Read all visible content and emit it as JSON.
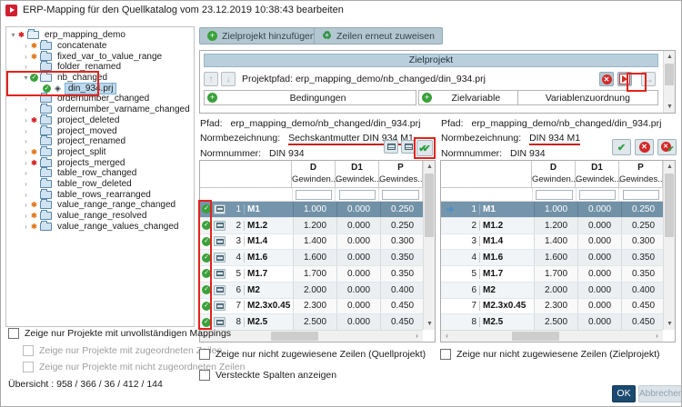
{
  "window": {
    "title": "ERP-Mapping für den Quellkatalog vom 23.12.2019 10:38:43 bearbeiten"
  },
  "toolbar": {
    "add_target_label": "Zielprojekt hinzufügen",
    "reassign_rows_label": "Zeilen erneut zuweisen"
  },
  "tree": {
    "items": [
      {
        "label": "erp_mapping_demo",
        "level": 0,
        "badge": "error",
        "icon": "folder-open",
        "expander": "expanded",
        "selected": false
      },
      {
        "label": "concatenate",
        "level": 1,
        "badge": "warning",
        "icon": "folder",
        "expander": "collapsed",
        "selected": false
      },
      {
        "label": "fixed_var_to_value_range",
        "level": 1,
        "badge": "warning",
        "icon": "folder",
        "expander": "collapsed",
        "selected": false
      },
      {
        "label": "folder_renamed",
        "level": 1,
        "badge": "none",
        "icon": "folder",
        "expander": "collapsed",
        "selected": false
      },
      {
        "label": "nb_changed",
        "level": 1,
        "badge": "ok",
        "icon": "folder-open",
        "expander": "expanded",
        "selected": false
      },
      {
        "label": "din_934.prj",
        "level": 2,
        "badge": "ok",
        "icon": "project",
        "expander": "none",
        "selected": true
      },
      {
        "label": "ordernumber_changed",
        "level": 1,
        "badge": "none",
        "icon": "folder",
        "expander": "collapsed",
        "selected": false
      },
      {
        "label": "ordernumber_varname_changed",
        "level": 1,
        "badge": "none",
        "icon": "folder",
        "expander": "collapsed",
        "selected": false
      },
      {
        "label": "project_deleted",
        "level": 1,
        "badge": "error",
        "icon": "folder",
        "expander": "collapsed",
        "selected": false
      },
      {
        "label": "project_moved",
        "level": 1,
        "badge": "none",
        "icon": "folder",
        "expander": "collapsed",
        "selected": false
      },
      {
        "label": "project_renamed",
        "level": 1,
        "badge": "none",
        "icon": "folder",
        "expander": "collapsed",
        "selected": false
      },
      {
        "label": "project_split",
        "level": 1,
        "badge": "warning",
        "icon": "folder",
        "expander": "collapsed",
        "selected": false
      },
      {
        "label": "projects_merged",
        "level": 1,
        "badge": "error",
        "icon": "folder",
        "expander": "collapsed",
        "selected": false
      },
      {
        "label": "table_row_changed",
        "level": 1,
        "badge": "none",
        "icon": "folder",
        "expander": "collapsed",
        "selected": false
      },
      {
        "label": "table_row_deleted",
        "level": 1,
        "badge": "none",
        "icon": "folder",
        "expander": "collapsed",
        "selected": false
      },
      {
        "label": "table_rows_rearranged",
        "level": 1,
        "badge": "none",
        "icon": "folder",
        "expander": "collapsed",
        "selected": false
      },
      {
        "label": "value_range_range_changed",
        "level": 1,
        "badge": "warning",
        "icon": "folder",
        "expander": "collapsed",
        "selected": false
      },
      {
        "label": "value_range_resolved",
        "level": 1,
        "badge": "warning",
        "icon": "folder",
        "expander": "collapsed",
        "selected": false
      },
      {
        "label": "value_range_values_changed",
        "level": 1,
        "badge": "warning",
        "icon": "folder",
        "expander": "collapsed",
        "selected": false
      }
    ]
  },
  "target_panel": {
    "header": "Zielprojekt",
    "project_path_label": "Projektpfad:",
    "project_path": "erp_mapping_demo/nb_changed/din_934.prj",
    "conditions_column": "Bedingungen",
    "target_variable_column": "Zielvariable",
    "variable_mapping_column": "Variablenzuordnung"
  },
  "source_detail": {
    "path_label": "Pfad:",
    "path": "erp_mapping_demo/nb_changed/din_934.prj",
    "designation_label": "Normbezeichnung:",
    "designation": "Sechskantmutter DIN 934  M1",
    "number_label": "Normnummer:",
    "number": "DIN 934"
  },
  "target_detail": {
    "path_label": "Pfad:",
    "path": "erp_mapping_demo/nb_changed/din_934.prj",
    "designation_label": "Normbezeichnung:",
    "designation": "DIN 934  M1",
    "number_label": "Normnummer:",
    "number": "DIN 934"
  },
  "table": {
    "columns": [
      {
        "title": "D",
        "subtitle": "Gewinden..."
      },
      {
        "title": "D1",
        "subtitle": "Gewindek..."
      },
      {
        "title": "P",
        "subtitle": "Gewindes..."
      }
    ],
    "rows": [
      {
        "num": "1",
        "label": "M1",
        "values": [
          "1.000",
          "0.000",
          "0.250"
        ],
        "selected": true
      },
      {
        "num": "2",
        "label": "M1.2",
        "values": [
          "1.200",
          "0.000",
          "0.250"
        ],
        "selected": false
      },
      {
        "num": "3",
        "label": "M1.4",
        "values": [
          "1.400",
          "0.000",
          "0.300"
        ],
        "selected": false
      },
      {
        "num": "4",
        "label": "M1.6",
        "values": [
          "1.600",
          "0.000",
          "0.350"
        ],
        "selected": false
      },
      {
        "num": "5",
        "label": "M1.7",
        "values": [
          "1.700",
          "0.000",
          "0.350"
        ],
        "selected": false
      },
      {
        "num": "6",
        "label": "M2",
        "values": [
          "2.000",
          "0.000",
          "0.400"
        ],
        "selected": false
      },
      {
        "num": "7",
        "label": "M2.3x0.45",
        "values": [
          "2.300",
          "0.000",
          "0.450"
        ],
        "selected": false
      },
      {
        "num": "8",
        "label": "M2.5",
        "values": [
          "2.500",
          "0.000",
          "0.450"
        ],
        "selected": false
      }
    ]
  },
  "filters": {
    "incomplete_mappings": "Zeige nur Projekte mit unvollständigen Mappings",
    "assigned_rows": "Zeige nur Projekte mit zugeordneten Zeilen",
    "unassigned_rows": "Zeige nur Projekte mit nicht zugeordneten Zeilen",
    "unassigned_source": "Zeige nur nicht zugewiesene Zeilen (Quellprojekt)",
    "unassigned_target": "Zeige nur nicht zugewiesene Zeilen (Zielprojekt)",
    "hidden_columns": "Versteckte Spalten anzeigen"
  },
  "overview_text": "Übersicht : 958 / 366 / 36 / 412 / 144",
  "footer": {
    "ok_label": "OK",
    "cancel_label": "Abbrechen"
  },
  "colors": {
    "annotation_red": "#e2231a",
    "selection_blue": "#7495ac",
    "ok_green": "#3aa13a",
    "warning_orange": "#e07818",
    "error_red": "#d42020",
    "ok_button_navy": "#1b4a70",
    "header_blue": "#b9d0dc"
  }
}
